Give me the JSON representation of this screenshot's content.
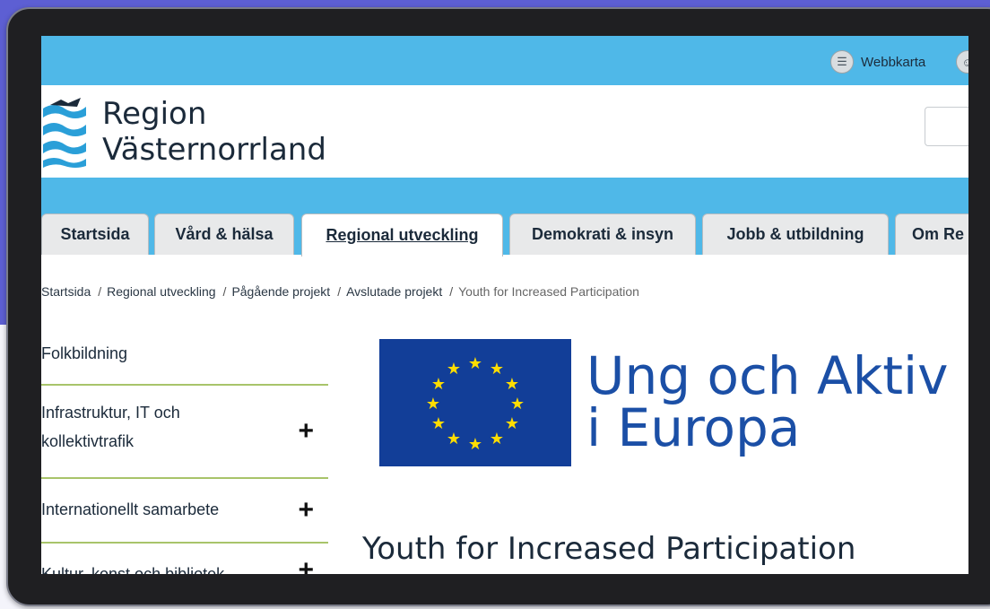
{
  "topbar": {
    "sitemap_label": "Webbkarta"
  },
  "header": {
    "logo_line1": "Region",
    "logo_line2": "Västernorrland"
  },
  "tabs": [
    {
      "label": "Startsida"
    },
    {
      "label": "Vård & hälsa"
    },
    {
      "label": "Regional utveckling",
      "active": true
    },
    {
      "label": "Demokrati & insyn"
    },
    {
      "label": "Jobb & utbildning"
    },
    {
      "label": "Om Re"
    }
  ],
  "breadcrumb": {
    "items": [
      "Startsida",
      "Regional utveckling",
      "Pågående projekt",
      "Avslutade projekt"
    ],
    "current": "Youth for Increased Participation",
    "separator": "/"
  },
  "sidenav": {
    "items": [
      {
        "label": "Folkbildning",
        "expandable": false
      },
      {
        "label": "Infrastruktur, IT och kollektivtrafik",
        "expandable": true
      },
      {
        "label": "Internationellt samarbete",
        "expandable": true
      },
      {
        "label": "Kultur, konst och bibliotek",
        "expandable": true
      }
    ],
    "expand_symbol": "+"
  },
  "content": {
    "eu_title_line1": "Ung och Aktiv",
    "eu_title_line2": "i Europa",
    "page_title": "Youth for Increased Participation"
  },
  "colors": {
    "topbar": "#4fb8e8",
    "nav_divider": "#a8c46a",
    "eu_blue": "#123e98",
    "eu_star": "#ffdd00",
    "eu_text": "#1b4fa6",
    "background": "#5d5fd3"
  },
  "icons": {
    "sitemap": "sitemap-icon",
    "user": "user-icon",
    "logo": "waves-logo-icon"
  }
}
